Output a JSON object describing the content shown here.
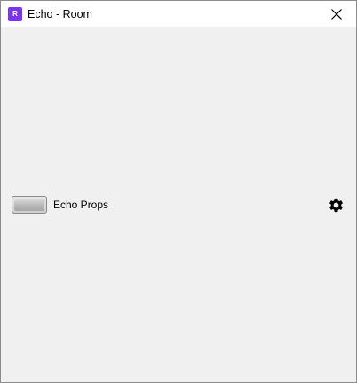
{
  "window": {
    "app_icon_letter": "R",
    "title": "Echo - Room"
  },
  "setting": {
    "label": "Echo Props",
    "toggle_state": "off"
  },
  "icons": {
    "app": "app-icon",
    "close": "close-icon",
    "settings": "gear-icon"
  },
  "colors": {
    "app_icon": "#7b35f2",
    "content_background": "#f0f0f0",
    "titlebar_background": "#ffffff"
  }
}
